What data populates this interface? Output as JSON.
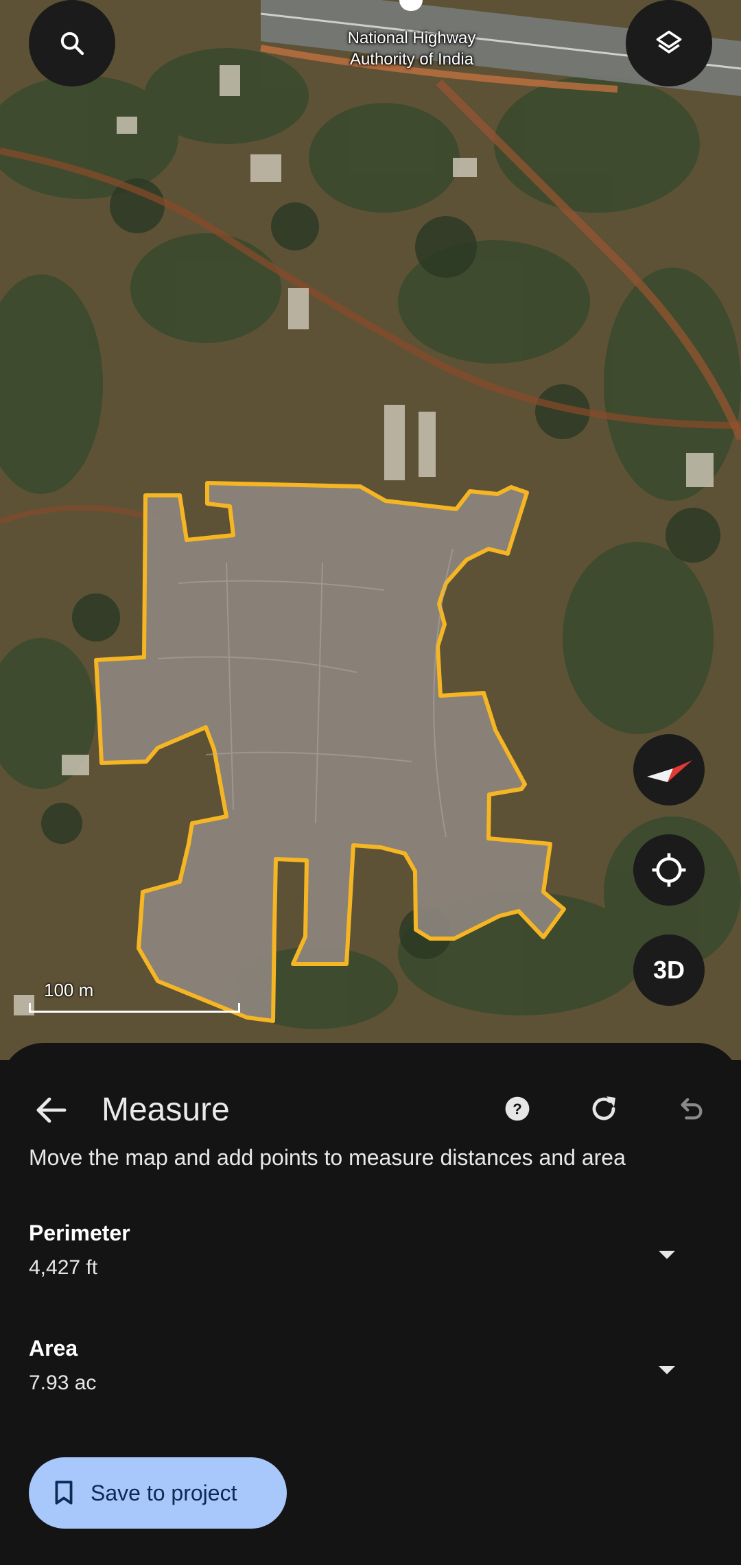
{
  "map": {
    "place_label": "National Highway Authority of India",
    "scale_label": "100 m",
    "icons": {
      "search": "search-icon",
      "layers": "layers-icon",
      "compass": "compass-icon",
      "location": "my-location-icon"
    },
    "three_d_label": "3D",
    "outline_color": "#f6b623"
  },
  "sheet": {
    "title": "Measure",
    "instructions": "Move the map and add points to measure distances and area",
    "icons": {
      "back": "arrow-back-icon",
      "help": "help-icon",
      "reset": "refresh-icon",
      "undo": "undo-icon"
    },
    "perimeter": {
      "label": "Perimeter",
      "value": "4,427 ft"
    },
    "area": {
      "label": "Area",
      "value": "7.93 ac"
    },
    "save_button": {
      "label": "Save to project",
      "icon": "bookmark-icon"
    }
  },
  "colors": {
    "sheet_bg": "#141414",
    "button_bg": "#a8c7fa",
    "button_text": "#0d2a57",
    "compass_red": "#e53935"
  }
}
